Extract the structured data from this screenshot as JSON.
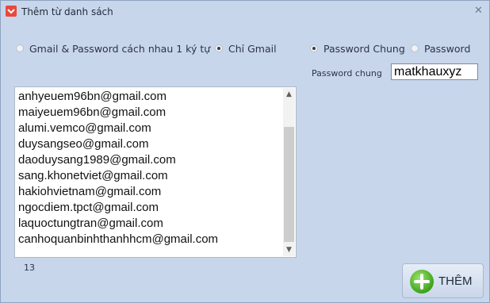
{
  "window": {
    "title": "Thêm từ danh sách"
  },
  "options": {
    "gmail_password_separate": "Gmail & Password cách nhau 1 ký tự",
    "only_gmail": "Chỉ Gmail",
    "password_shared": "Password Chung",
    "password": "Password",
    "selected_mode": "only_gmail",
    "selected_password": "password_shared"
  },
  "password_field": {
    "label": "Password chung",
    "value": "matkhauxyz"
  },
  "emails": [
    "anhyeuem96bn@gmail.com",
    "maiyeuem96bn@gmail.com",
    "alumi.vemco@gmail.com",
    "duysangseo@gmail.com",
    "daoduysang1989@gmail.com",
    "sang.khonetviet@gmail.com",
    "hakiohvietnam@gmail.com",
    "ngocdiem.tpct@gmail.com",
    "laquoctungtran@gmail.com",
    "canhoquanbinhthanhhcm@gmail.com"
  ],
  "count": "13",
  "add_button": {
    "label": "THÊM"
  },
  "icons": {
    "app": "app-icon",
    "close": "close-icon",
    "add": "plus-icon"
  }
}
